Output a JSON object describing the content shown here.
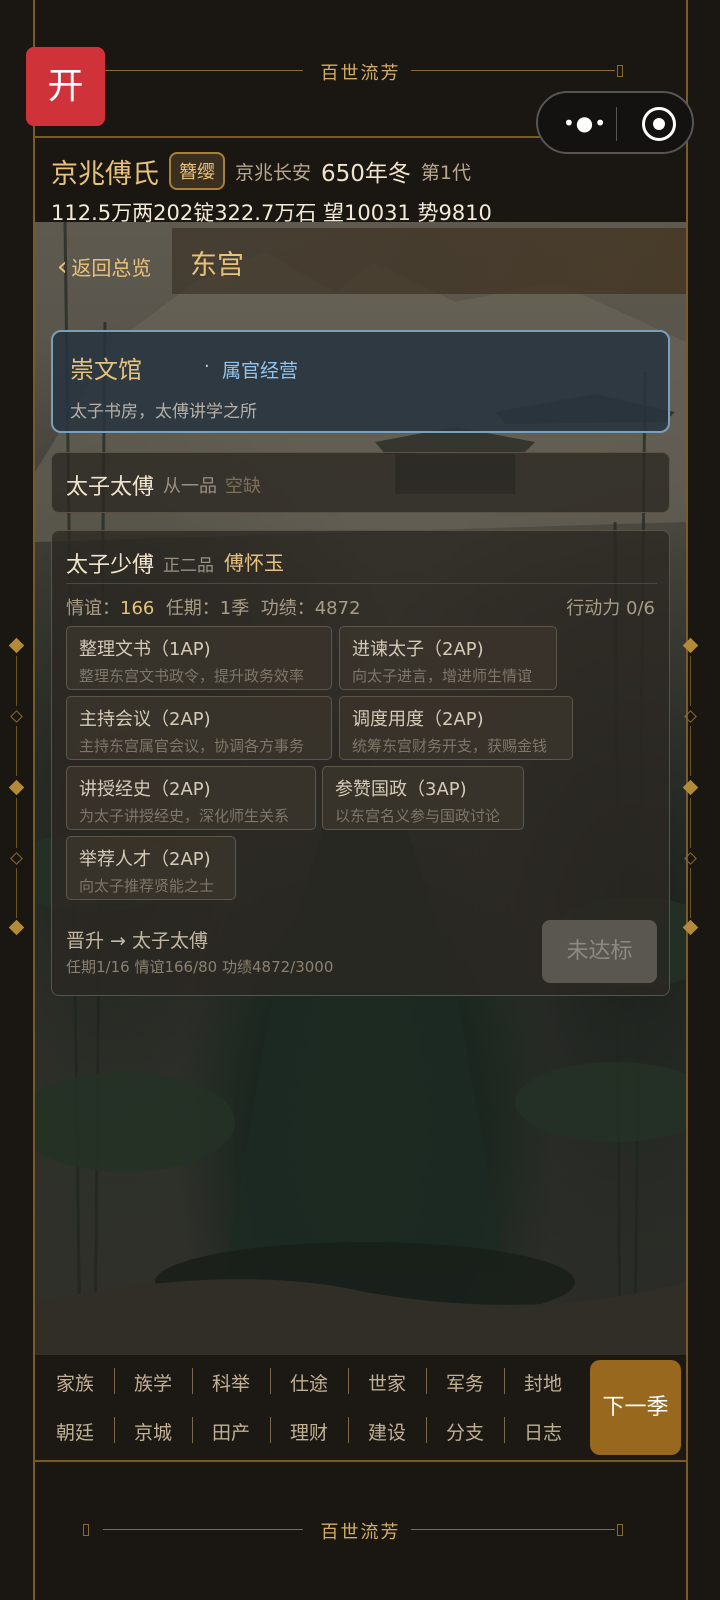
{
  "app": {
    "banner_title": "百世流芳",
    "open_label": "开"
  },
  "capsule": {
    "more_glyph": "•●•"
  },
  "header": {
    "clan_name": "京兆傅氏",
    "rank_badge": "簪缨",
    "place": "京兆长安",
    "year": "650年冬",
    "generation": "第1代",
    "resources": "112.5万两202锭322.7万石  望10031 势9810"
  },
  "page": {
    "back_label": "返回总览",
    "section_title": "东宫"
  },
  "office": {
    "name": "崇文馆",
    "dot": "·",
    "tag": "属官经营",
    "description": "太子书房，太傅讲学之所"
  },
  "vacant_post": {
    "title": "太子太傅",
    "grade": "从一品",
    "status": "空缺"
  },
  "active_post": {
    "title": "太子少傅",
    "grade": "正二品",
    "holder": "傅怀玉",
    "favor_label": "情谊：",
    "favor_value": "166",
    "term": "任期：1季",
    "merit": "功绩：4872",
    "ap": "行动力 0/6",
    "actions": [
      {
        "name": "整理文书（1AP)",
        "desc": "整理东宫文书政令，提升政务效率"
      },
      {
        "name": "进谏太子（2AP)",
        "desc": "向太子进言，增进师生情谊"
      },
      {
        "name": "主持会议（2AP)",
        "desc": "主持东宫属官会议，协调各方事务"
      },
      {
        "name": "调度用度（2AP)",
        "desc": "统筹东宫财务开支，获赐金钱"
      },
      {
        "name": "讲授经史（2AP)",
        "desc": "为太子讲授经史，深化师生关系"
      },
      {
        "name": "参赞国政（3AP)",
        "desc": "以东宫名义参与国政讨论"
      },
      {
        "name": "举荐人才（2AP)",
        "desc": "向太子推荐贤能之士"
      }
    ],
    "promotion": {
      "title": "晋升 → 太子太傅",
      "requirements": "任期1/16  情谊166/80  功绩4872/3000",
      "button": "未达标"
    }
  },
  "nav": {
    "row1": [
      "家族",
      "族学",
      "科举",
      "仕途",
      "世家",
      "军务",
      "封地"
    ],
    "row2": [
      "朝廷",
      "京城",
      "田产",
      "理财",
      "建设",
      "分支",
      "日志"
    ],
    "next_label": "下一季"
  },
  "colors": {
    "accent_gold": "#e7c27c",
    "frame": "#7a5a28",
    "open_red": "#d0323a",
    "next_brown": "#98681e",
    "office_border": "#7a9fb8"
  }
}
